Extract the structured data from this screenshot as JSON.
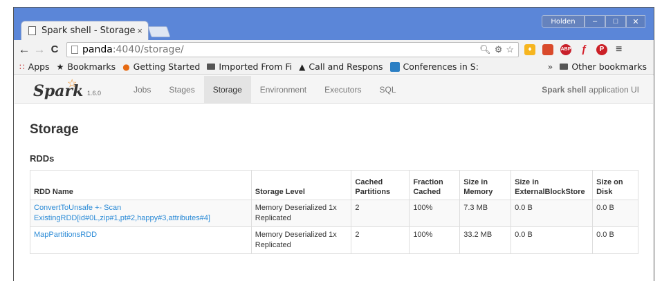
{
  "window": {
    "user_button": "Holden",
    "min_label": "–",
    "max_label": "□",
    "close_label": "✕"
  },
  "tab": {
    "title": "Spark shell - Storage",
    "close": "×"
  },
  "address_bar": {
    "host": "panda",
    "path": ":4040/storage/"
  },
  "nav_icons": {
    "back": "←",
    "forward": "→",
    "reload": "C",
    "menu": "≡"
  },
  "bookmarks": [
    {
      "label": "Apps",
      "icon": "apps-grid-icon"
    },
    {
      "label": "Bookmarks",
      "icon": "star-icon"
    },
    {
      "label": "Getting Started",
      "icon": "firefox-icon"
    },
    {
      "label": "Imported From Fi",
      "icon": "folder-icon"
    },
    {
      "label": "Call and Respons",
      "icon": "triangle-icon"
    },
    {
      "label": "Conferences in S:",
      "icon": "trello-icon"
    }
  ],
  "bookmarks_more": "»",
  "other_bookmarks": "Other bookmarks",
  "spark": {
    "logo_text": "Spark",
    "version": "1.6.0",
    "tabs": [
      "Jobs",
      "Stages",
      "Storage",
      "Environment",
      "Executors",
      "SQL"
    ],
    "active_tab": "Storage",
    "app_name_bold": "Spark shell",
    "app_name_rest": "application UI",
    "page_title": "Storage",
    "section_title": "RDDs",
    "table": {
      "headers": [
        "RDD Name",
        "Storage Level",
        "Cached Partitions",
        "Fraction Cached",
        "Size in Memory",
        "Size in ExternalBlockStore",
        "Size on Disk"
      ],
      "rows": [
        [
          "ConvertToUnsafe +- Scan ExistingRDD[id#0L,zip#1,pt#2,happy#3,attributes#4]",
          "Memory Deserialized 1x Replicated",
          "2",
          "100%",
          "7.3 MB",
          "0.0 B",
          "0.0 B"
        ],
        [
          "MapPartitionsRDD",
          "Memory Deserialized 1x Replicated",
          "2",
          "100%",
          "33.2 MB",
          "0.0 B",
          "0.0 B"
        ]
      ]
    }
  }
}
